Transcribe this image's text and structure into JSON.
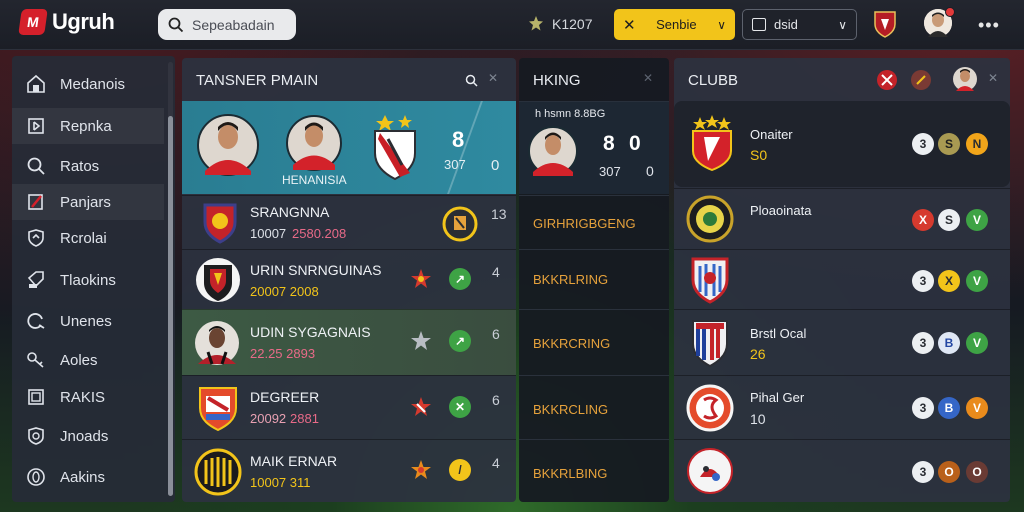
{
  "app": {
    "logo_letter": "M",
    "logo_text": "Ugruh"
  },
  "search": {
    "placeholder": "Sepeabadain"
  },
  "coins": {
    "value": "K1207"
  },
  "filter_button": {
    "label": "Senbie"
  },
  "view_button": {
    "label": "dsid"
  },
  "sidebar": {
    "items": [
      {
        "label": "Medanois",
        "icon": "house-icon"
      },
      {
        "label": "Repnka",
        "icon": "document-icon"
      },
      {
        "label": "Ratos",
        "icon": "search-icon"
      },
      {
        "label": "Panjars",
        "icon": "flag-icon"
      },
      {
        "label": "Rcrolai",
        "icon": "shield-icon"
      },
      {
        "label": "Tlaokins",
        "icon": "tag-icon"
      },
      {
        "label": "Unenes",
        "icon": "refresh-icon"
      },
      {
        "label": "Aoles",
        "icon": "key-icon"
      },
      {
        "label": "RAKIS",
        "icon": "square-icon"
      },
      {
        "label": "Jnoads",
        "icon": "badge-icon"
      },
      {
        "label": "Aakins",
        "icon": "circle-icon"
      }
    ]
  },
  "transfer": {
    "title": "TANSNER PMAIN",
    "featured": {
      "caption": "HENANISIA",
      "score_top": "8",
      "score_mid": "307",
      "score_right": "0"
    },
    "rows": [
      {
        "name": "SRANGNNA",
        "value": "10007",
        "value2": "2580.208",
        "right": "13"
      },
      {
        "name": "URIN SNRNGUINAS",
        "value": "20007 2008",
        "value2": "",
        "right": "4"
      },
      {
        "name": "UDIN SYGAGNAIS",
        "value": "22.25 2893",
        "value2": "",
        "right": "6"
      },
      {
        "name": "DEGREER",
        "value": "20092",
        "value2": "2881",
        "right": "6"
      },
      {
        "name": "MAIK ERNAR",
        "value": "10007 311",
        "value2": "",
        "right": "4"
      }
    ]
  },
  "live": {
    "title": "HKING",
    "featured": {
      "caption": "h hsmn 8.8BG",
      "score_a": "8",
      "score_b": "0",
      "score_c": "307",
      "score_d": "0"
    },
    "rows": [
      {
        "label": "GIRHRIGBGENG"
      },
      {
        "label": "BKKRLRING"
      },
      {
        "label": "BKKRCRING"
      },
      {
        "label": "BKKRCLING"
      },
      {
        "label": "BKKRLBING"
      }
    ]
  },
  "clubs": {
    "title": "CLUBB",
    "rows": [
      {
        "name": "Onaiter",
        "value": "S0",
        "buttons": [
          "3",
          "S",
          "N"
        ]
      },
      {
        "name": "Ploaoinata",
        "value": "",
        "buttons": [
          "X",
          "S",
          "V"
        ]
      },
      {
        "name": "",
        "value": "",
        "buttons": [
          "3",
          "X",
          "V"
        ]
      },
      {
        "name": "Brstl Ocal",
        "value": "26",
        "buttons": [
          "3",
          "B",
          "V"
        ]
      },
      {
        "name": "Pihal Ger",
        "value": "10",
        "buttons": [
          "3",
          "B",
          "V"
        ]
      },
      {
        "name": "",
        "value": "",
        "buttons": [
          "3",
          "O",
          "O"
        ]
      }
    ]
  },
  "colors": {
    "accent_yellow": "#f2c41a",
    "accent_teal": "#2a7d92",
    "brand_red": "#d5202b"
  }
}
